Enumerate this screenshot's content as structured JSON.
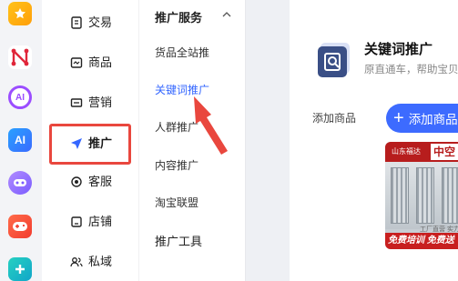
{
  "nav": {
    "items": [
      {
        "label": "交易",
        "icon": "document-icon"
      },
      {
        "label": "商品",
        "icon": "image-icon"
      },
      {
        "label": "营销",
        "icon": "ticket-icon"
      },
      {
        "label": "推广",
        "icon": "send-icon"
      },
      {
        "label": "客服",
        "icon": "headset-icon"
      },
      {
        "label": "店铺",
        "icon": "store-icon"
      },
      {
        "label": "私域",
        "icon": "users-icon"
      }
    ],
    "active": "推广"
  },
  "submenu": {
    "header1": "推广服务",
    "items": [
      "货品全站推",
      "关键词推广",
      "人群推广",
      "内容推广",
      "淘宝联盟"
    ],
    "active": "关键词推广",
    "header2": "推广工具"
  },
  "main": {
    "title": "关键词推广",
    "subtitle": "原直通车，帮助宝贝",
    "add_label": "添加商品",
    "add_button": "添加商品",
    "thumbnail": {
      "brand": "山东福达",
      "brand_big": "中空",
      "caption": "工厂直营 实力",
      "footer": "免费培训 免费送"
    }
  },
  "colors": {
    "accent": "#3d6bff",
    "annotation": "#e9473e",
    "active_link": "#3366ff"
  }
}
